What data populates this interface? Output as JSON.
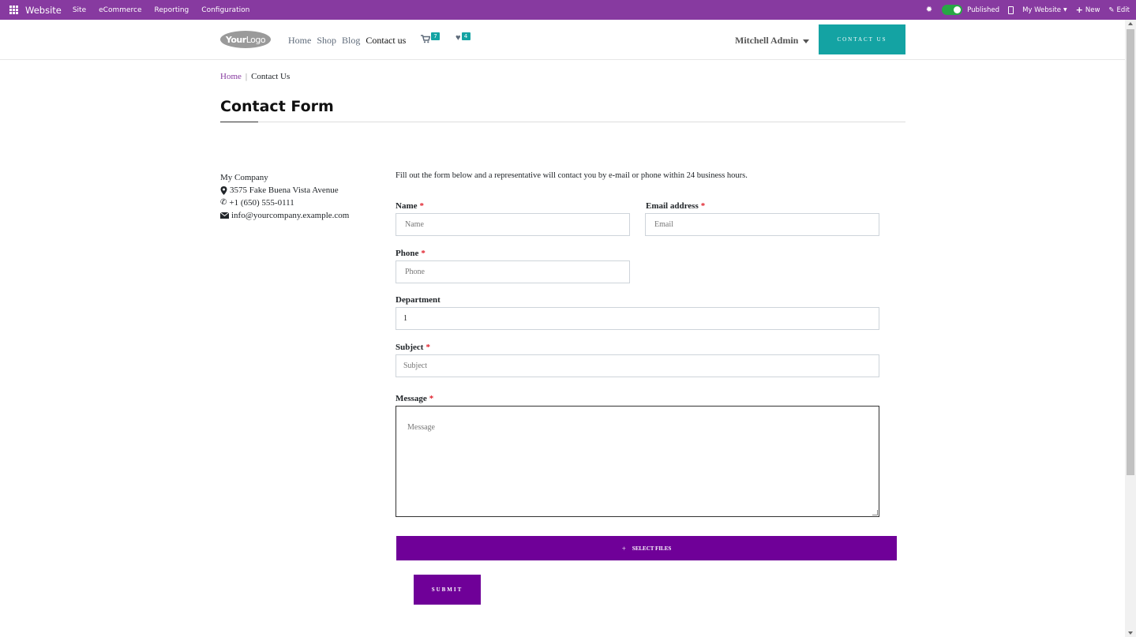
{
  "adminbar": {
    "brand": "Website",
    "menu": [
      "Site",
      "eCommerce",
      "Reporting",
      "Configuration"
    ],
    "published_label": "Published",
    "website_label": "My Website",
    "new_label": "New",
    "edit_label": "Edit"
  },
  "header": {
    "logo_text_bold": "Your",
    "logo_text_rest": "Logo",
    "nav": [
      "Home",
      "Shop",
      "Blog",
      "Contact us"
    ],
    "active_nav": "Contact us",
    "cart_count": "7",
    "wishlist_count": "4",
    "user_name": "Mitchell Admin",
    "cta_label": "CONTACT US"
  },
  "breadcrumb": {
    "home": "Home",
    "separator": "|",
    "current": "Contact Us"
  },
  "page_title": "Contact Form",
  "company": {
    "name": "My Company",
    "address": "3575 Fake Buena Vista Avenue",
    "phone": "+1 (650) 555-0111",
    "email": "info@yourcompany.example.com"
  },
  "form": {
    "intro": "Fill out the form below and a representative will contact you by e-mail or phone within 24 business hours.",
    "required_mark": "*",
    "name_label": "Name",
    "name_placeholder": "Name",
    "email_label": "Email address",
    "email_placeholder": "Email",
    "phone_label": "Phone",
    "phone_placeholder": "Phone",
    "department_label": "Department",
    "department_value": "1",
    "subject_label": "Subject",
    "subject_placeholder": "Subject",
    "message_label": "Message",
    "message_placeholder": "Message",
    "files_label": "SELECT FILES",
    "files_plus": "+",
    "submit_label": "SUBMIT"
  },
  "colors": {
    "admin_bar": "#873aa0",
    "accent_teal": "#14a3a3",
    "button_purple": "#6f0098",
    "required_red": "#e0232e",
    "published_green": "#28a745"
  }
}
